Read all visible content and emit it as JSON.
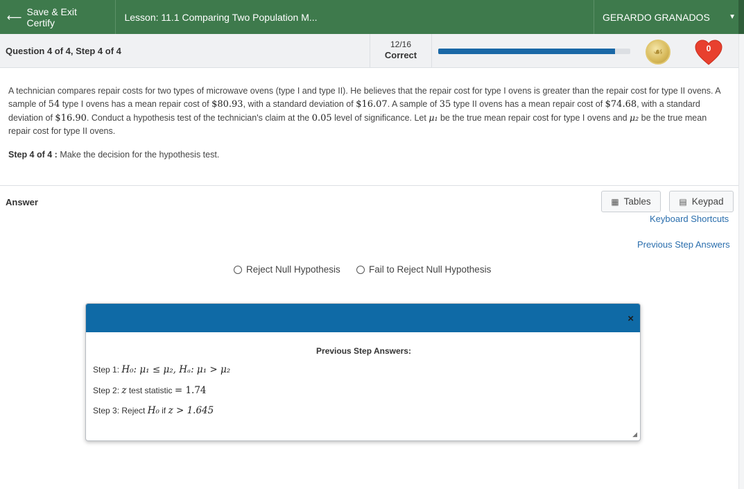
{
  "topbar": {
    "save_label": "Save & Exit Certify",
    "lesson_title": "Lesson: 11.1 Comparing Two Population M...",
    "user_name": "GERARDO GRANADOS"
  },
  "status": {
    "question_label": "Question 4 of 4, Step 4 of 4",
    "score": "12/16",
    "score_caption": "Correct",
    "progress_fraction": 0.92,
    "hearts": "0",
    "colors": {
      "progress": "#1a68a6",
      "heart": "#e8402e",
      "topbar": "#3e7a4c"
    }
  },
  "question": {
    "p1": "A technician compares repair costs for two types of microwave ovens (type I and type II).  He believes that the repair cost for type I ovens is greater than the repair cost for type II ovens.  A sample of ",
    "n1": "54",
    "p2": " type I ovens has a mean repair cost of ",
    "mean1": "$80.93",
    "p3": ", with a standard deviation of ",
    "sd1": "$16.07",
    "p4": ".  A sample of ",
    "n2": "35",
    "p5": " type II ovens has a mean repair cost of ",
    "mean2": "$74.68",
    "p6": ", with a standard deviation of ",
    "sd2": "$16.90",
    "p7": ".  Conduct a hypothesis test of the technician's claim at the ",
    "alpha": "0.05",
    "p8": " level of significance.  Let ",
    "mu1": "μ₁",
    "p9": " be the true mean repair cost for type I ovens and ",
    "mu2": "μ₂",
    "p10": " be the true mean repair cost for type II ovens.",
    "step_label": "Step 4 of 4 :",
    "step_text": " Make the decision for the hypothesis test."
  },
  "answer": {
    "label": "Answer",
    "tables_label": "Tables",
    "keypad_label": "Keypad",
    "keyboard_shortcuts": "Keyboard Shortcuts",
    "previous_step_answers": "Previous Step Answers",
    "options": [
      "Reject Null Hypothesis",
      "Fail to Reject Null Hypothesis"
    ]
  },
  "popup": {
    "title": "Previous Step Answers:",
    "close": "×",
    "step1_label": "Step 1:",
    "step1_math": "H₀: μ₁ ≤ μ₂, Hₐ: μ₁ > μ₂",
    "step2_label": "Step 2:",
    "step2_var": "z",
    "step2_text": " test statistic ",
    "step2_math": "= 1.74",
    "step3_label": "Step 3:",
    "step3_text1": " Reject ",
    "step3_h0": "H₀",
    "step3_text2": " if ",
    "step3_math": "z > 1.645"
  }
}
